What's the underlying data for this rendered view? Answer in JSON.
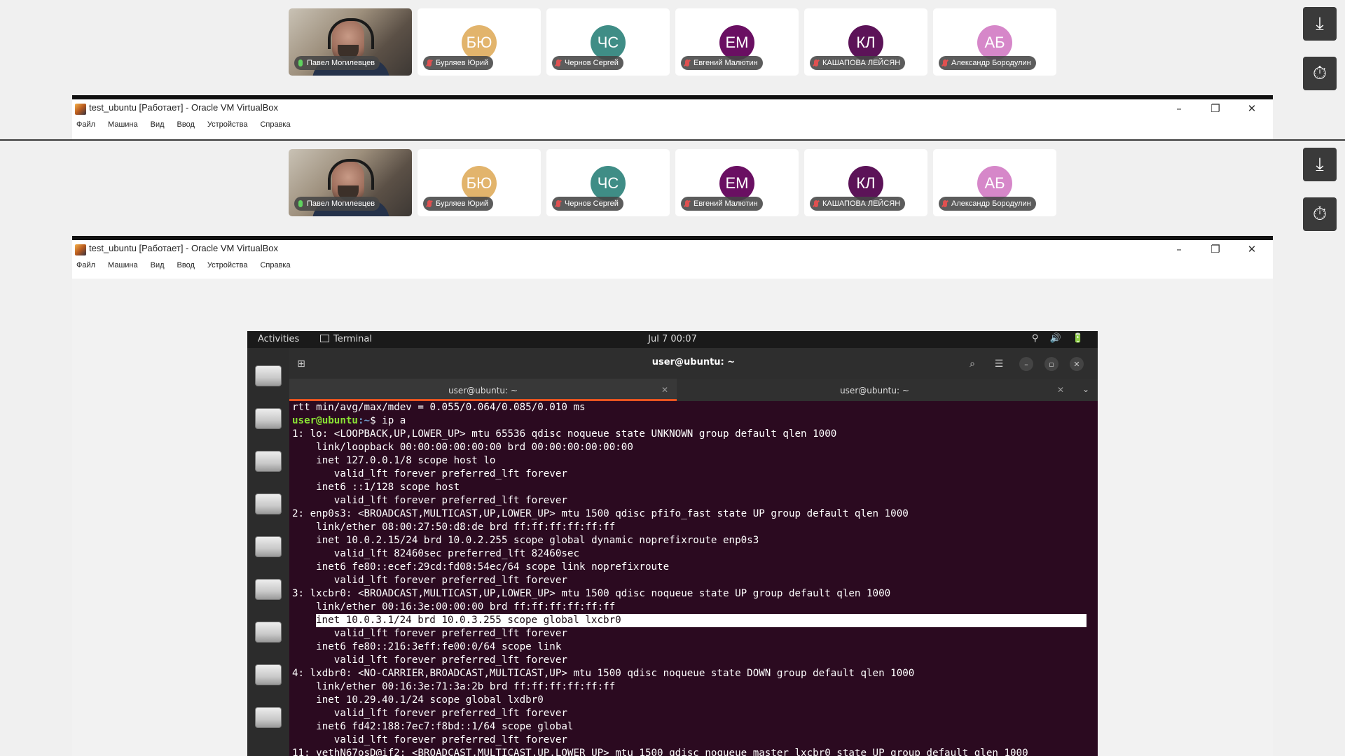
{
  "participants": [
    {
      "name": "Павел Могилевцев",
      "initials": "",
      "color": "",
      "mic": "on",
      "video": true
    },
    {
      "name": "Бурляев Юрий",
      "initials": "БЮ",
      "color": "#e2b46c",
      "mic": "off"
    },
    {
      "name": "Чернов Сергей",
      "initials": "ЧС",
      "color": "#3f8d86",
      "mic": "off"
    },
    {
      "name": "Евгений Малютин",
      "initials": "ЕМ",
      "color": "#6a0f62",
      "mic": "off"
    },
    {
      "name": "КАШАПОВА ЛЕЙСЯН",
      "initials": "КЛ",
      "color": "#5c1358",
      "mic": "off"
    },
    {
      "name": "Александр Бородулин",
      "initials": "АБ",
      "color": "#d687c9",
      "mic": "off"
    }
  ],
  "side_buttons": {
    "download_icon": "download-icon",
    "timer_icon": "timer-icon"
  },
  "vbox": {
    "title": "test_ubuntu [Работает] - Oracle VM VirtualBox",
    "menu": [
      "Файл",
      "Машина",
      "Вид",
      "Ввод",
      "Устройства",
      "Справка"
    ]
  },
  "ubuntu": {
    "activities": "Activities",
    "app_name": "Terminal",
    "clock": "Jul 7  00:07",
    "tray": "⚲ 🔊 🔋",
    "window_title": "user@ubuntu: ~",
    "tabs": [
      {
        "label": "user@ubuntu: ~",
        "active": true
      },
      {
        "label": "user@ubuntu: ~",
        "active": false
      }
    ]
  },
  "terminal": {
    "prompt_user": "user@ubuntu",
    "prompt_path": ":~",
    "prompt_symbol": "$ ",
    "command": "ip a",
    "lines": [
      "rtt min/avg/max/mdev = 0.055/0.064/0.085/0.010 ms",
      "",
      "1: lo: <LOOPBACK,UP,LOWER_UP> mtu 65536 qdisc noqueue state UNKNOWN group default qlen 1000",
      "    link/loopback 00:00:00:00:00:00 brd 00:00:00:00:00:00",
      "    inet 127.0.0.1/8 scope host lo",
      "       valid_lft forever preferred_lft forever",
      "    inet6 ::1/128 scope host",
      "       valid_lft forever preferred_lft forever",
      "2: enp0s3: <BROADCAST,MULTICAST,UP,LOWER_UP> mtu 1500 qdisc pfifo_fast state UP group default qlen 1000",
      "    link/ether 08:00:27:50:d8:de brd ff:ff:ff:ff:ff:ff",
      "    inet 10.0.2.15/24 brd 10.0.2.255 scope global dynamic noprefixroute enp0s3",
      "       valid_lft 82460sec preferred_lft 82460sec",
      "    inet6 fe80::ecef:29cd:fd08:54ec/64 scope link noprefixroute",
      "       valid_lft forever preferred_lft forever",
      "3: lxcbr0: <BROADCAST,MULTICAST,UP,LOWER_UP> mtu 1500 qdisc noqueue state UP group default qlen 1000",
      "    link/ether 00:16:3e:00:00:00 brd ff:ff:ff:ff:ff:ff",
      "inet 10.0.3.1/24 brd 10.0.3.255 scope global lxcbr0",
      "       valid_lft forever preferred_lft forever",
      "    inet6 fe80::216:3eff:fe00:0/64 scope link",
      "       valid_lft forever preferred_lft forever",
      "4: lxdbr0: <NO-CARRIER,BROADCAST,MULTICAST,UP> mtu 1500 qdisc noqueue state DOWN group default qlen 1000",
      "    link/ether 00:16:3e:71:3a:2b brd ff:ff:ff:ff:ff:ff",
      "    inet 10.29.40.1/24 scope global lxdbr0",
      "       valid_lft forever preferred_lft forever",
      "    inet6 fd42:188:7ec7:f8bd::1/64 scope global",
      "       valid_lft forever preferred_lft forever",
      "11: vethN67osD@if2: <BROADCAST,MULTICAST,UP,LOWER_UP> mtu 1500 qdisc noqueue master lxcbr0 state UP group default qlen 1000"
    ],
    "highlighted_line": 16
  }
}
